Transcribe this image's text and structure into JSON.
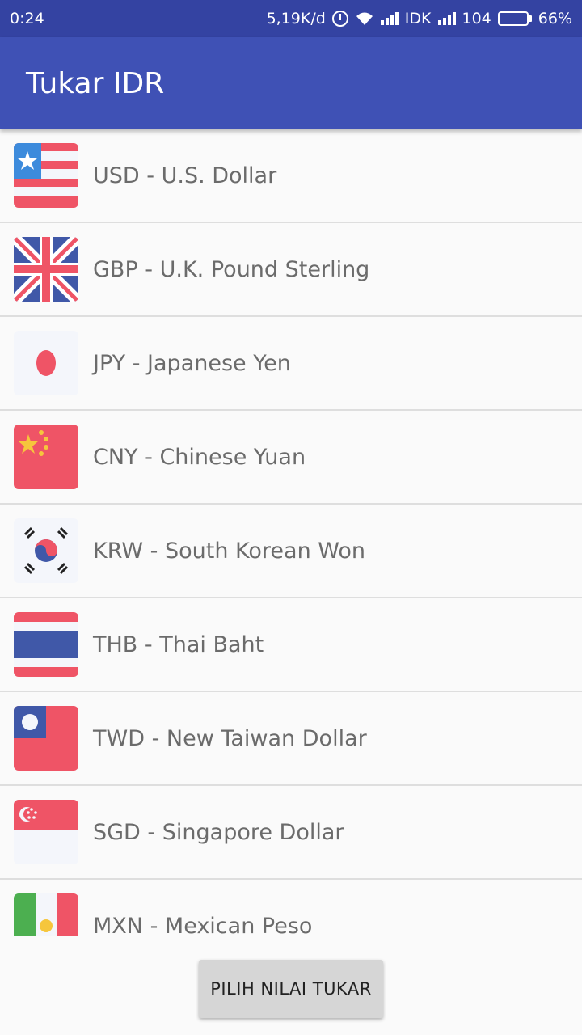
{
  "status_bar": {
    "time": "0:24",
    "network_speed": "5,19K/d",
    "carrier": "IDK",
    "signal_value": "104",
    "battery": "66%",
    "battery_level": 0.66
  },
  "app_bar": {
    "title": "Tukar IDR"
  },
  "currencies": [
    {
      "label": "USD - U.S. Dollar",
      "flag": "usd-flag-icon"
    },
    {
      "label": "GBP - U.K. Pound Sterling",
      "flag": "gbp-flag-icon"
    },
    {
      "label": "JPY - Japanese Yen",
      "flag": "jpy-flag-icon"
    },
    {
      "label": "CNY - Chinese Yuan",
      "flag": "cny-flag-icon"
    },
    {
      "label": "KRW - South Korean Won",
      "flag": "krw-flag-icon"
    },
    {
      "label": "THB - Thai Baht",
      "flag": "thb-flag-icon"
    },
    {
      "label": "TWD - New Taiwan Dollar",
      "flag": "twd-flag-icon"
    },
    {
      "label": "SGD - Singapore Dollar",
      "flag": "sgd-flag-icon"
    },
    {
      "label": "MXN - Mexican Peso",
      "flag": "mxn-flag-icon"
    }
  ],
  "button": {
    "label": "PILIH NILAI TUKAR"
  },
  "colors": {
    "status_bar": "#3443a2",
    "app_bar": "#3f51b5",
    "flag_red": "#ef5466",
    "flag_blue": "#4058a8",
    "flag_white": "#f4f6fb",
    "button_bg": "#d6d6d6"
  }
}
